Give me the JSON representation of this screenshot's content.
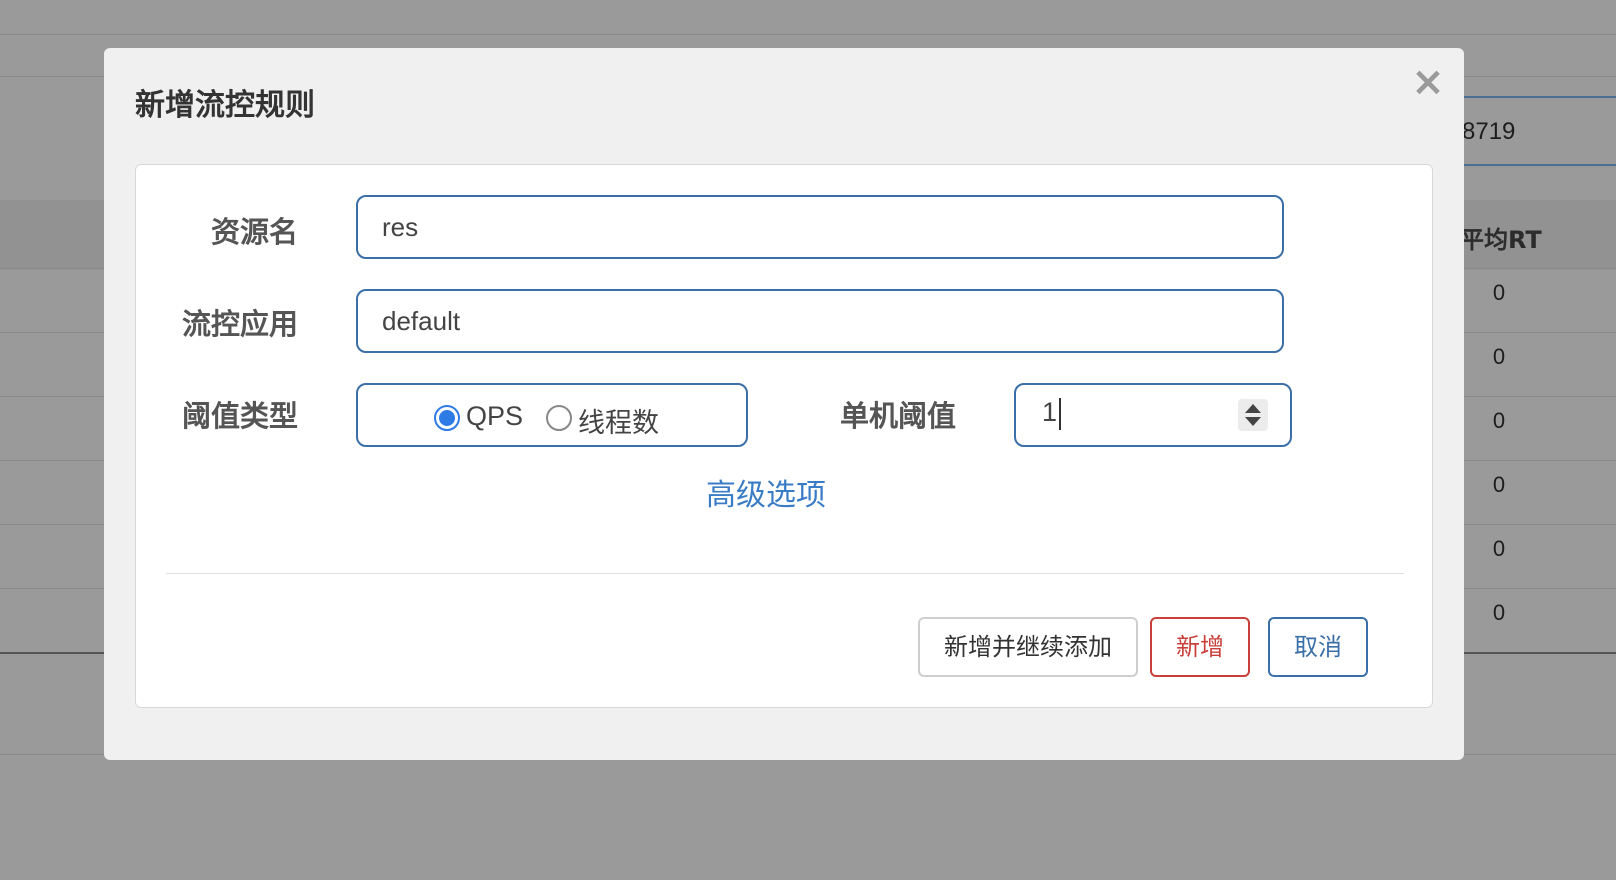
{
  "background": {
    "port_text": "8719",
    "column_header": "平均RT",
    "cells": [
      "0",
      "0",
      "0",
      "0",
      "0",
      "0"
    ]
  },
  "modal": {
    "title": "新增流控规则",
    "close_icon": "×",
    "form": {
      "resource_label": "资源名",
      "resource_value": "res",
      "app_label": "流控应用",
      "app_value": "default",
      "threshold_type_label": "阈值类型",
      "threshold_type_options": [
        "QPS",
        "线程数"
      ],
      "threshold_type_selected": "QPS",
      "threshold_label": "单机阈值",
      "threshold_value": "1",
      "advanced_link": "高级选项"
    },
    "buttons": {
      "add_and_continue": "新增并继续添加",
      "add": "新增",
      "cancel": "取消"
    }
  },
  "colors": {
    "primary": "#3b6fa8",
    "danger": "#c9403a",
    "radio_checked": "#2f7be6",
    "link": "#3a7cc5"
  }
}
